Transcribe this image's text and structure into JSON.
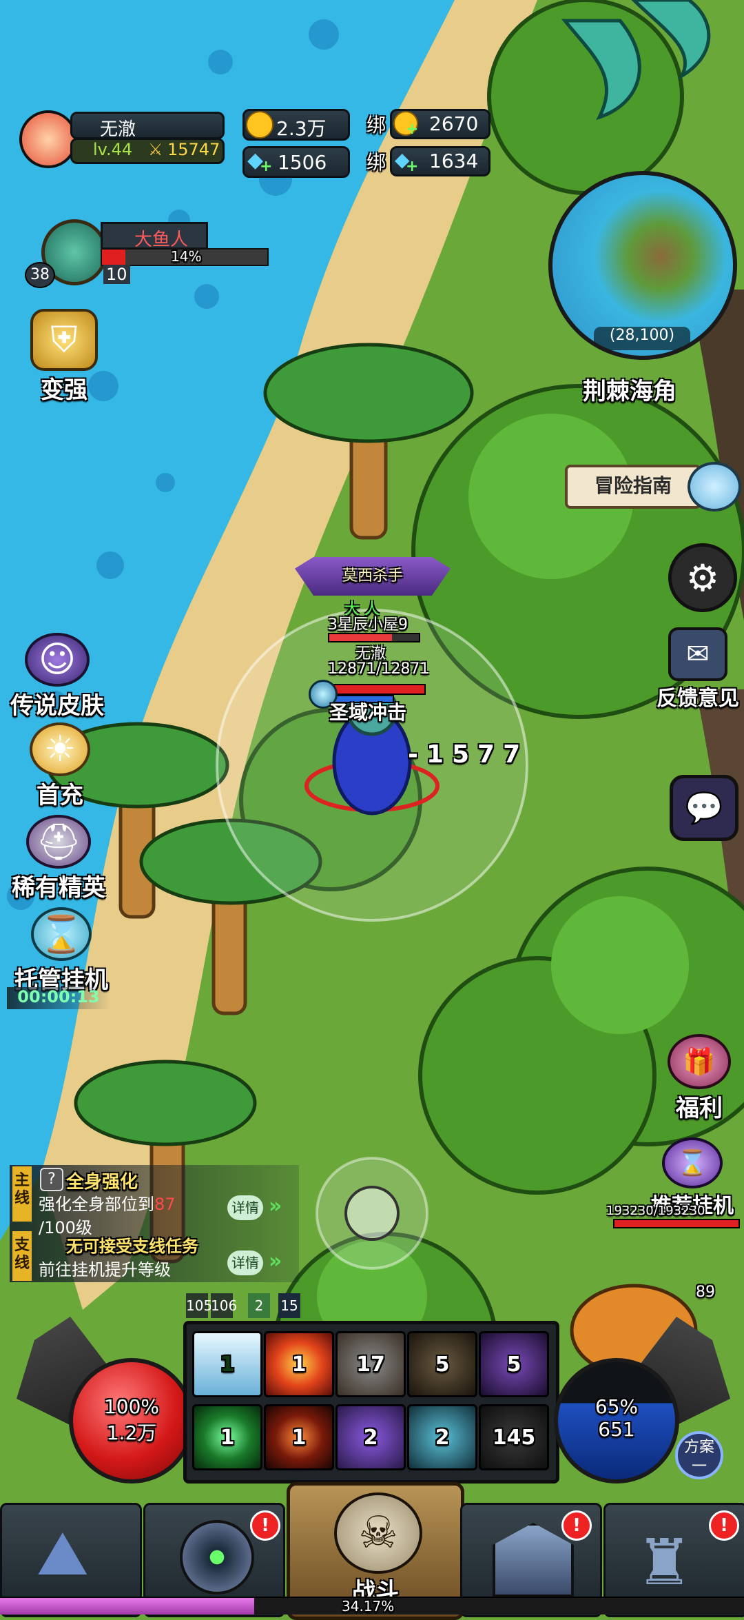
{
  "player": {
    "name": "无澈",
    "level": "lv.44",
    "power": "15747"
  },
  "currency": {
    "gold": "2.3万",
    "bound_gold_label": "绑",
    "bound_gold": "2670",
    "gems": "1506",
    "bound_gems_label": "绑",
    "bound_gems": "1634"
  },
  "boss": {
    "name": "大鱼人",
    "percent": "14%",
    "level": "38",
    "count": "10"
  },
  "left_menu": {
    "strengthen": "变强",
    "legend_skin": "传说皮肤",
    "first_recharge": "首充",
    "rare_elite": "稀有精英",
    "auto_idle": "托管挂机",
    "timer": "00:00:13"
  },
  "minimap": {
    "coords": "(28,100)",
    "zone": "荆棘海角"
  },
  "right_menu": {
    "guide": "冒险指南",
    "feedback": "反馈意见",
    "welfare": "福利",
    "recommend_idle": "推荐挂机"
  },
  "hero": {
    "title_banner": "莫西杀手",
    "title_line2": "大 人",
    "house": "3星辰小屋9",
    "name": "无澈",
    "hp": "12871/12871",
    "skill_name": "圣域冲击",
    "damage": "-1577"
  },
  "enemy": {
    "hp_text": "193230/193230",
    "level": "89"
  },
  "quests": {
    "main_tag": "主线",
    "main_title": "全身强化",
    "main_desc_prefix": "强化全身部位到",
    "main_progress": "87",
    "main_desc_suffix": "/100级",
    "side_tag": "支线",
    "side_title": "无可接受支线任务",
    "side_desc": "前往挂机提升等级",
    "detail": "详情"
  },
  "buffs": [
    "105",
    "106",
    "2",
    "15"
  ],
  "skills_row1": [
    "1",
    "1",
    "17",
    "5",
    "5"
  ],
  "skills_row2": [
    "1",
    "1",
    "2",
    "2",
    "145"
  ],
  "hp_orb": {
    "percent": "100%",
    "value": "1.2万"
  },
  "mp_orb": {
    "percent": "65%",
    "value": "651"
  },
  "plan_button": "方案一",
  "nav": {
    "battle": "战斗"
  },
  "exp": {
    "percent": "34.17%",
    "fraction": 0.3417
  },
  "colors": {
    "sea": "#35b8e6",
    "sand": "#e8cc8a",
    "grass": "#6aa83a",
    "hp_red": "#e02020",
    "mp_blue": "#1e4fbf",
    "gold_text": "#ffd84a"
  }
}
